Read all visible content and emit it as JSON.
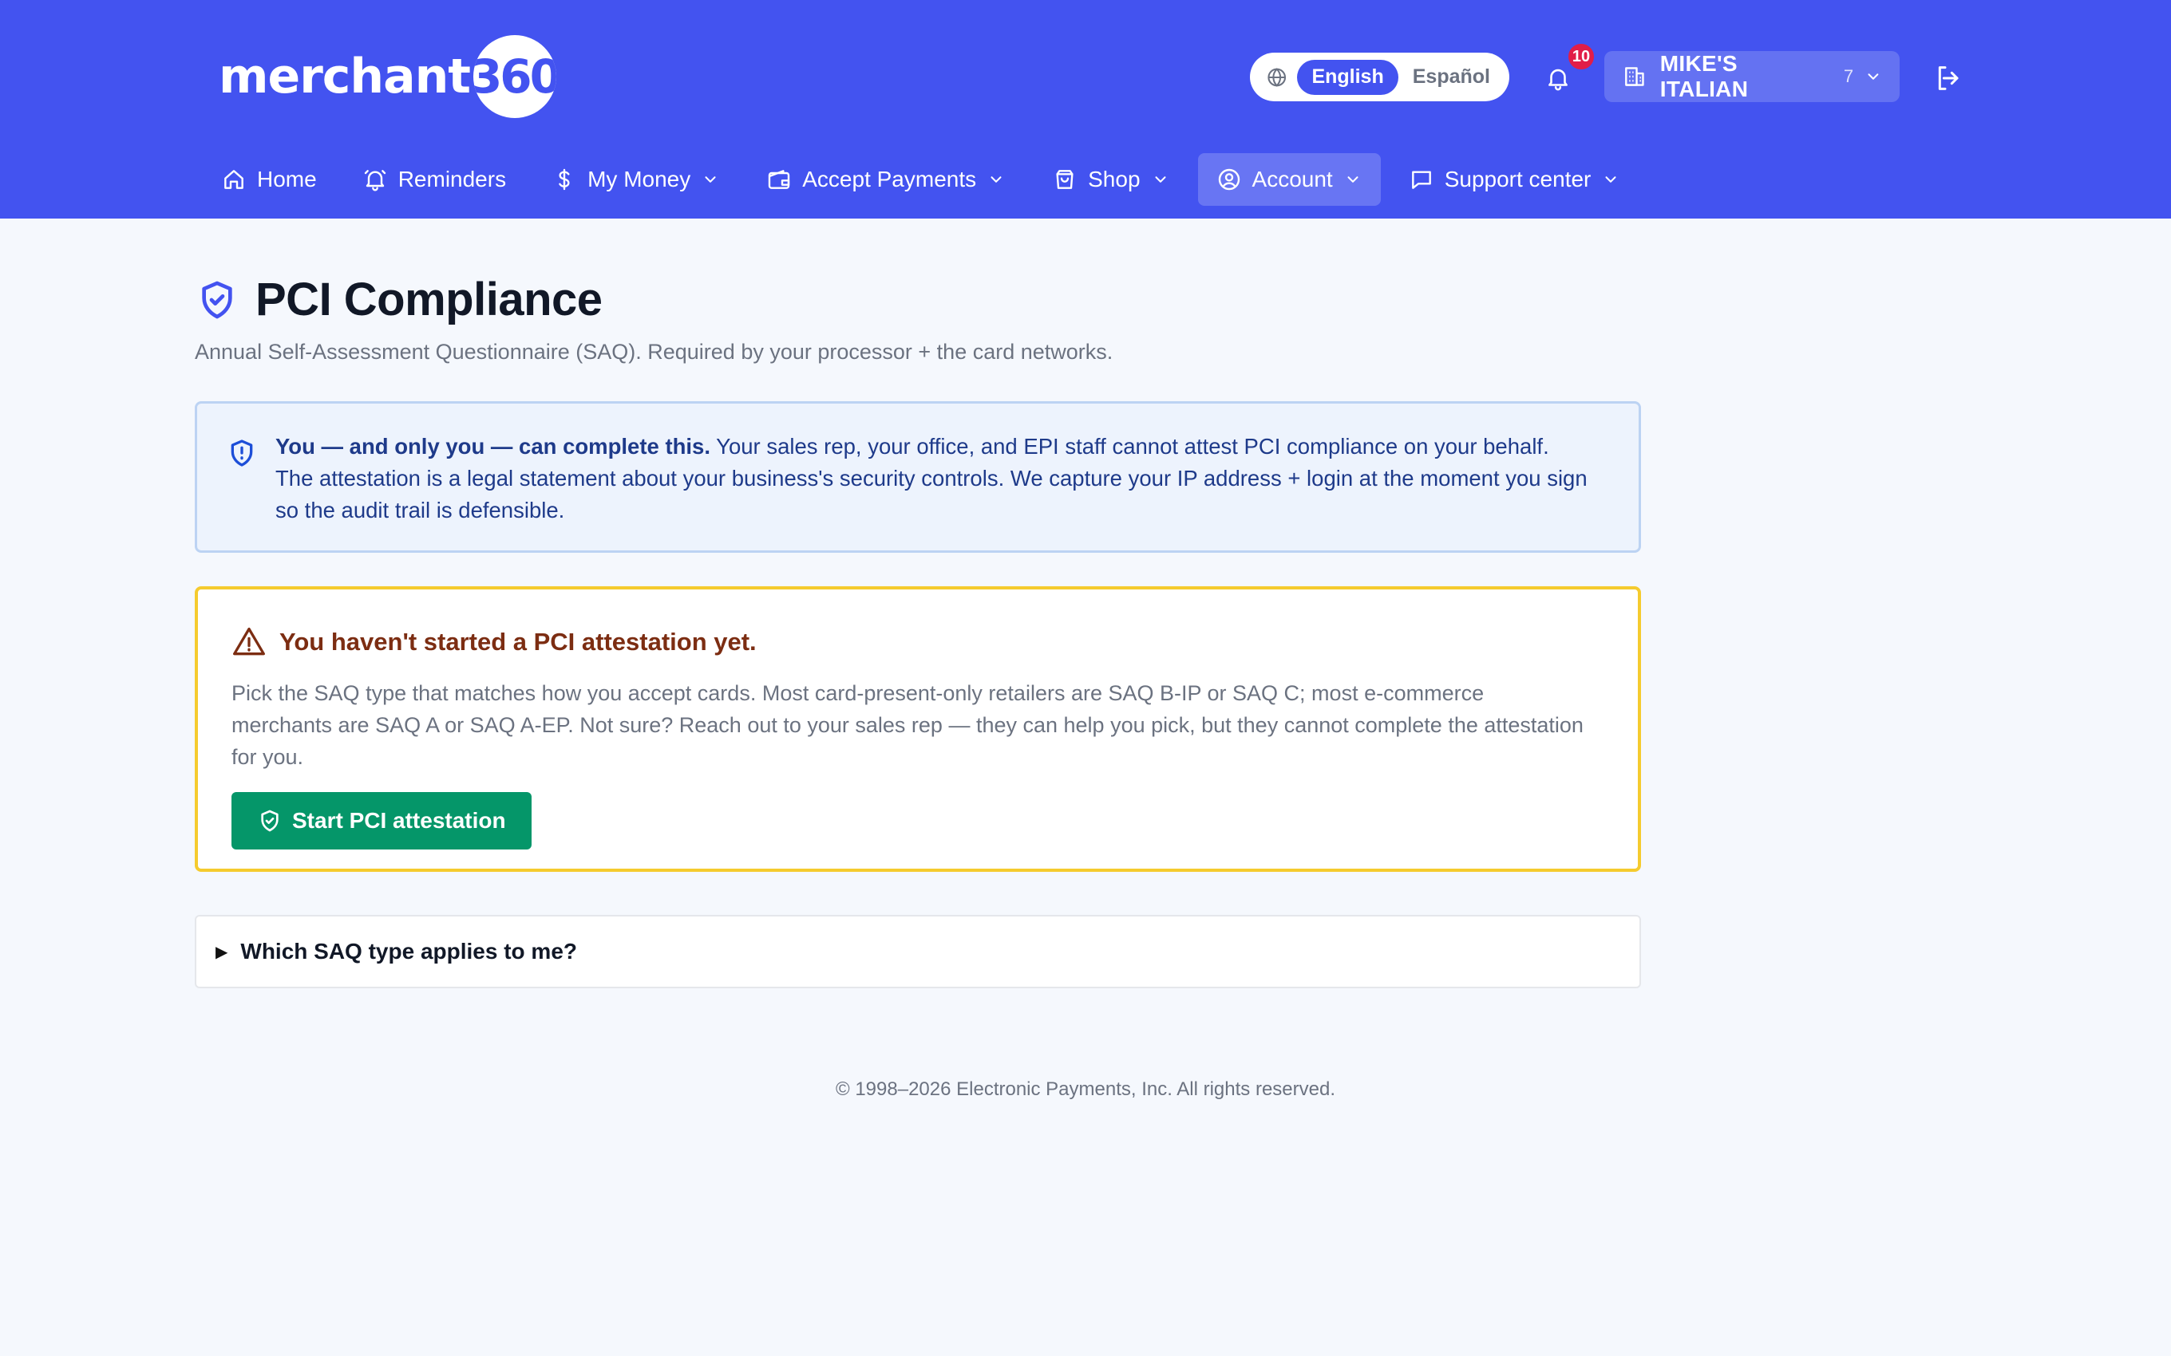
{
  "brand": {
    "name": "merchant",
    "badge": "360"
  },
  "header": {
    "languages": [
      {
        "label": "English",
        "active": true
      },
      {
        "label": "Español",
        "active": false
      }
    ],
    "notifications_count": "10",
    "merchant": {
      "name": "MIKE'S ITALIAN",
      "count": "7"
    }
  },
  "nav": {
    "items": [
      {
        "label": "Home",
        "icon": "home-icon",
        "has_dropdown": false
      },
      {
        "label": "Reminders",
        "icon": "bell-icon",
        "has_dropdown": false
      },
      {
        "label": "My Money",
        "icon": "dollar-icon",
        "has_dropdown": true
      },
      {
        "label": "Accept Payments",
        "icon": "wallet-icon",
        "has_dropdown": true
      },
      {
        "label": "Shop",
        "icon": "shopping-bag-icon",
        "has_dropdown": true
      },
      {
        "label": "Account",
        "icon": "user-circle-icon",
        "has_dropdown": true,
        "active": true
      },
      {
        "label": "Support center",
        "icon": "message-icon",
        "has_dropdown": true
      }
    ]
  },
  "page": {
    "title": "PCI Compliance",
    "subtitle": "Annual Self-Assessment Questionnaire (SAQ). Required by your processor + the card networks."
  },
  "info": {
    "strong": "You — and only you — can complete this.",
    "text": " Your sales rep, your office, and EPI staff cannot attest PCI compliance on your behalf. The attestation is a legal statement about your business's security controls. We capture your IP address + login at the moment you sign so the audit trail is defensible."
  },
  "warning": {
    "title": "You haven't started a PCI attestation yet.",
    "body": "Pick the SAQ type that matches how you accept cards. Most card-present-only retailers are SAQ B-IP or SAQ C; most e-commerce merchants are SAQ A or SAQ A-EP. Not sure? Reach out to your sales rep — they can help you pick, but they cannot complete the attestation for you.",
    "button_label": "Start PCI attestation"
  },
  "faq": {
    "label": "Which SAQ type applies to me?"
  },
  "footer": {
    "copyright": "© 1998–2026 Electronic Payments, Inc. All rights reserved."
  },
  "colors": {
    "header_bg": "#4353f0",
    "page_bg": "#f5f8fd",
    "info_bg": "#edf3fd",
    "info_border": "#bcd3f3",
    "warning_border": "#f5cb2e",
    "warning_title": "#7c2d12",
    "button_green": "#059669",
    "badge_red": "#e11d48"
  }
}
